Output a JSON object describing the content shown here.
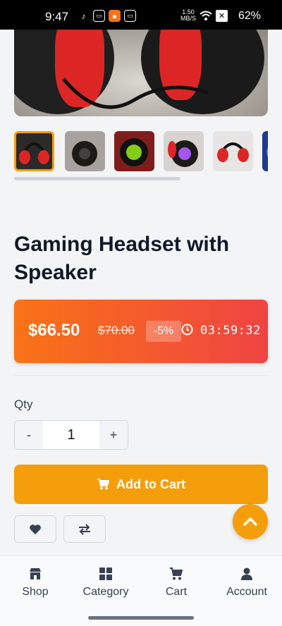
{
  "status_bar": {
    "time": "9:47",
    "net_speed": "1.50",
    "net_unit": "MB/S",
    "battery": "62%"
  },
  "product": {
    "title": "Gaming Headset with Speaker",
    "price": "$66.50",
    "old_price": "$70.00",
    "discount": "-5%",
    "countdown": "03:59:32",
    "image_count_visible": 6,
    "active_image": 1
  },
  "quantity": {
    "label": "Qty",
    "minus": "-",
    "value": "1",
    "plus": "+"
  },
  "actions": {
    "add_to_cart": "Add to Cart"
  },
  "icons": {
    "cart": "cart-icon",
    "heart": "heart-icon",
    "compare": "compare-icon",
    "scroll_top": "chevron-up-icon",
    "clock": "clock-icon"
  },
  "bottom_nav": {
    "items": [
      {
        "label": "Shop",
        "icon": "store-icon"
      },
      {
        "label": "Category",
        "icon": "grid-icon"
      },
      {
        "label": "Cart",
        "icon": "cart-icon"
      },
      {
        "label": "Account",
        "icon": "user-icon"
      }
    ]
  },
  "colors": {
    "accent": "#f59e0b",
    "price_gradient_start": "#f97316",
    "price_gradient_end": "#ef4444"
  }
}
